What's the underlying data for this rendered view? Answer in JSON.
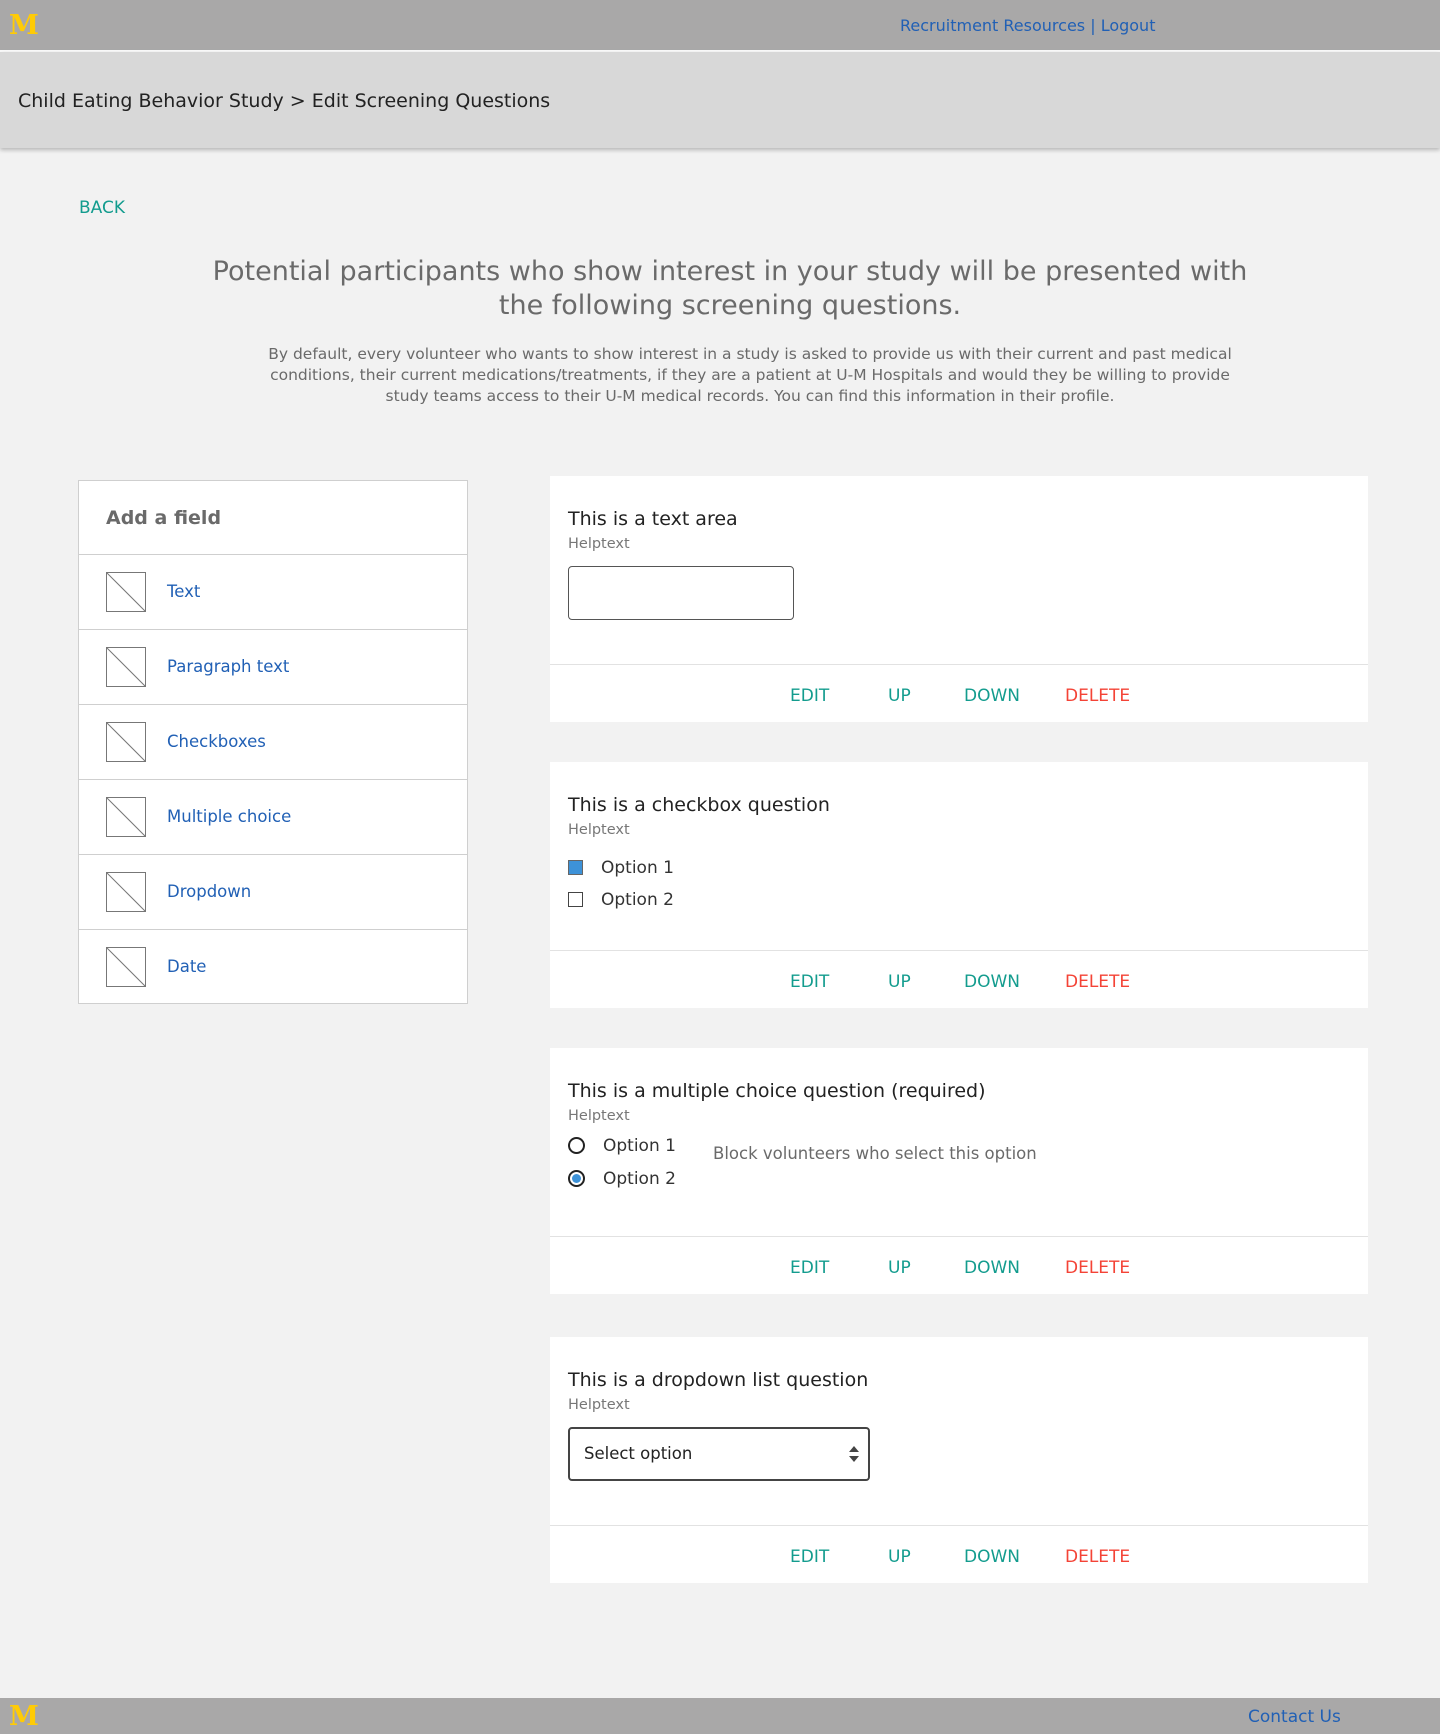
{
  "header": {
    "logo": "M",
    "recruitment_resources": "Recruitment Resources",
    "separator": " | ",
    "logout": "Logout"
  },
  "breadcrumb": "Child Eating Behavior Study > Edit Screening Questions",
  "back": "BACK",
  "headline": "Potential participants who show interest in your study will be presented with the following screening questions.",
  "description": "By default, every volunteer who wants to show interest in a study is asked to provide us with their current and past medical conditions, their current medications/treatments, if they are a patient at U-M Hospitals and would they be willing to provide study teams access to their U-M medical records. You can find this information in their profile.",
  "add_field": {
    "title": "Add a field",
    "items": [
      {
        "label": "Text",
        "icon": "placeholder-image-icon"
      },
      {
        "label": "Paragraph text",
        "icon": "placeholder-image-icon"
      },
      {
        "label": "Checkboxes",
        "icon": "placeholder-image-icon"
      },
      {
        "label": "Multiple choice",
        "icon": "placeholder-image-icon"
      },
      {
        "label": "Dropdown",
        "icon": "placeholder-image-icon"
      },
      {
        "label": "Date",
        "icon": "placeholder-image-icon"
      }
    ]
  },
  "actions": {
    "edit": "EDIT",
    "up": "UP",
    "down": "DOWN",
    "delete": "DELETE"
  },
  "questions": [
    {
      "title": "This is a text area",
      "help": "Helptext",
      "type": "textarea",
      "value": ""
    },
    {
      "title": "This is a checkbox question",
      "help": "Helptext",
      "type": "checkbox",
      "options": [
        {
          "label": "Option 1",
          "checked": true
        },
        {
          "label": "Option 2",
          "checked": false
        }
      ]
    },
    {
      "title": "This is a multiple choice question (required)",
      "help": "Helptext",
      "type": "radio",
      "options": [
        {
          "label": "Option 1",
          "checked": false
        },
        {
          "label": "Option 2",
          "checked": true
        }
      ],
      "block_note": "Block volunteers who select this option"
    },
    {
      "title": "This is a dropdown list question",
      "help": "Helptext",
      "type": "select",
      "selected": "Select option"
    }
  ],
  "footer": {
    "logo": "M",
    "contact": "Contact Us"
  },
  "colors": {
    "brand_yellow": "#ffcb05",
    "link_blue": "#2160b5",
    "teal": "#139c8e",
    "delete_red": "#f44336",
    "checked_blue": "#3d92d8"
  }
}
